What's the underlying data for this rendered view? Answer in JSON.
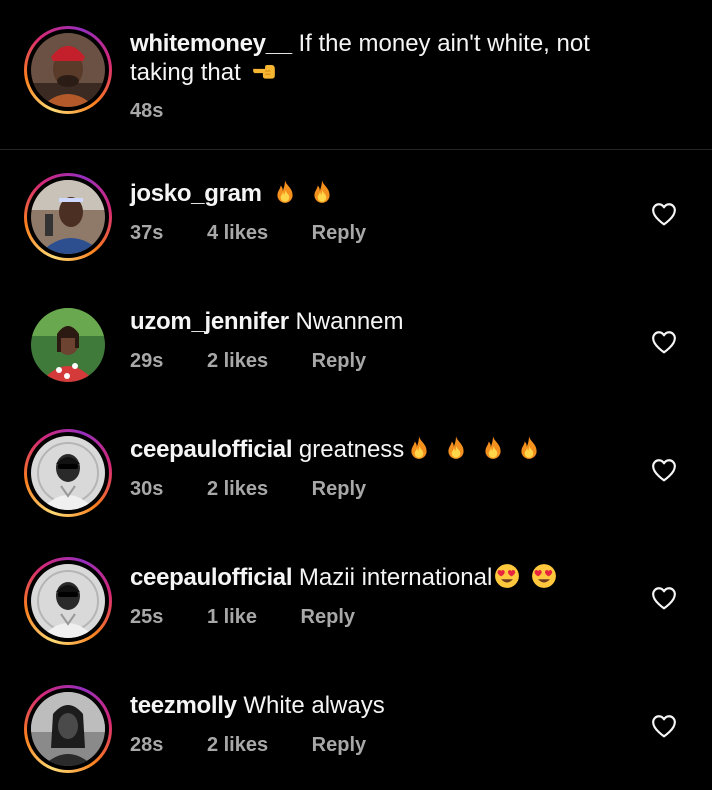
{
  "caption": {
    "username": "whitemoney__",
    "text": "If the money ain't white, not taking that",
    "emoji": "hand-pointing-left-emoji",
    "time": "48s"
  },
  "comments": [
    {
      "username": "josko_gram",
      "text": "",
      "emojis": [
        "fire-emoji",
        "fire-emoji"
      ],
      "time": "37s",
      "likes": "4 likes",
      "reply": "Reply"
    },
    {
      "username": "uzom_jennifer",
      "text": "Nwannem",
      "emojis": [],
      "time": "29s",
      "likes": "2 likes",
      "reply": "Reply"
    },
    {
      "username": "ceepaulofficial",
      "text": "greatness",
      "emojis": [
        "fire-emoji",
        "fire-emoji",
        "fire-emoji",
        "fire-emoji"
      ],
      "time": "30s",
      "likes": "2 likes",
      "reply": "Reply"
    },
    {
      "username": "ceepaulofficial",
      "text": "Mazii international",
      "emojis": [
        "heart-eyes-emoji",
        "heart-eyes-emoji"
      ],
      "time": "25s",
      "likes": "1 like",
      "reply": "Reply"
    },
    {
      "username": "teezmolly",
      "text": "White always",
      "emojis": [],
      "time": "28s",
      "likes": "2 likes",
      "reply": "Reply"
    }
  ],
  "colors": {
    "background": "#000000",
    "text": "#f5f5f5",
    "meta": "#a8a8a8",
    "divider": "#262626"
  },
  "icons": {
    "like": "heart-outline-icon"
  }
}
